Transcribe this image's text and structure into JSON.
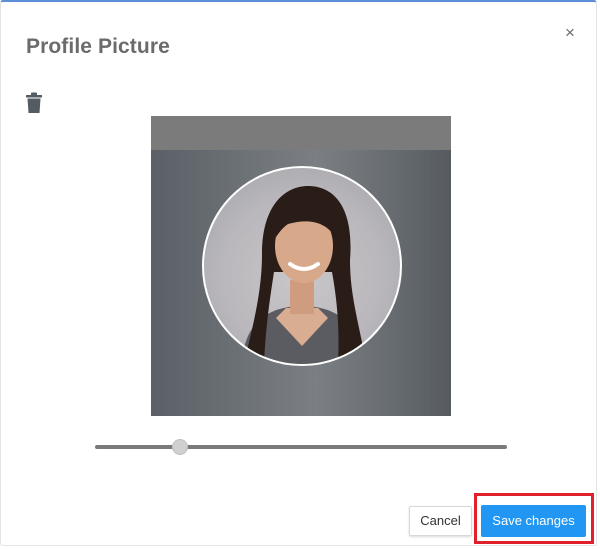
{
  "dialog": {
    "title": "Profile Picture",
    "close_label": "×"
  },
  "toolbar": {
    "delete_icon": "trash-icon"
  },
  "zoom_slider": {
    "value": 0.195
  },
  "actions": {
    "cancel_label": "Cancel",
    "save_label": "Save changes"
  },
  "colors": {
    "primary": "#2196f3",
    "highlight": "#e0202a"
  }
}
